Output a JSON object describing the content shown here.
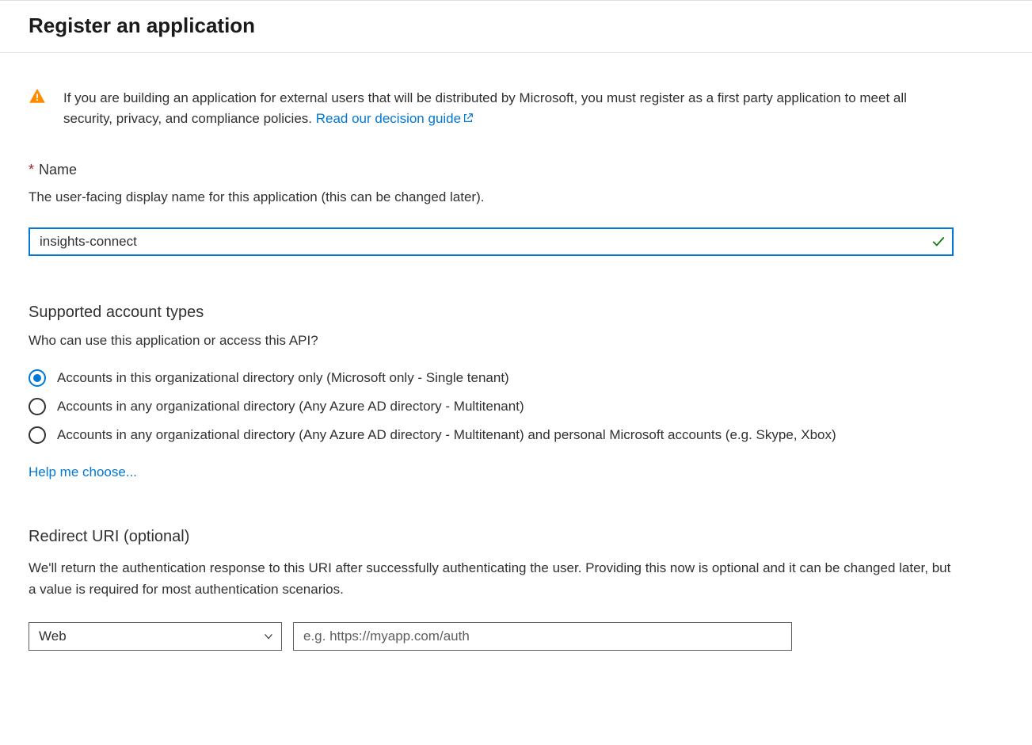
{
  "header": {
    "title": "Register an application"
  },
  "alert": {
    "text_before_link": "If you are building an application for external users that will be distributed by Microsoft, you must register as a first party application to meet all security, privacy, and compliance policies. ",
    "link_text": "Read our decision guide"
  },
  "name_section": {
    "label": "Name",
    "help": "The user-facing display name for this application (this can be changed later).",
    "value": "insights-connect"
  },
  "account_types": {
    "title": "Supported account types",
    "help": "Who can use this application or access this API?",
    "options": [
      {
        "label": "Accounts in this organizational directory only (Microsoft only - Single tenant)",
        "selected": true
      },
      {
        "label": "Accounts in any organizational directory (Any Azure AD directory - Multitenant)",
        "selected": false
      },
      {
        "label": "Accounts in any organizational directory (Any Azure AD directory - Multitenant) and personal Microsoft accounts (e.g. Skype, Xbox)",
        "selected": false
      }
    ],
    "help_link": "Help me choose..."
  },
  "redirect": {
    "title": "Redirect URI (optional)",
    "help": "We'll return the authentication response to this URI after successfully authenticating the user. Providing this now is optional and it can be changed later, but a value is required for most authentication scenarios.",
    "platform_value": "Web",
    "uri_placeholder": "e.g. https://myapp.com/auth",
    "uri_value": ""
  }
}
